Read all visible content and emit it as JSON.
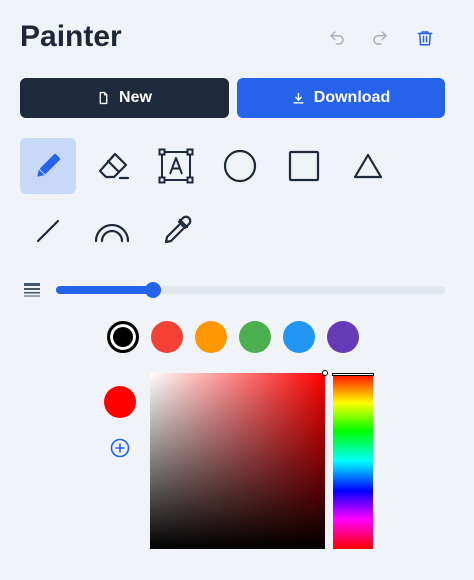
{
  "header": {
    "title": "Painter"
  },
  "actions": {
    "new_label": "New",
    "download_label": "Download"
  },
  "tools": [
    {
      "name": "pencil",
      "icon": "pencil-icon",
      "active": true
    },
    {
      "name": "eraser",
      "icon": "eraser-icon",
      "active": false
    },
    {
      "name": "text",
      "icon": "text-box-icon",
      "active": false
    },
    {
      "name": "circle",
      "icon": "circle-icon",
      "active": false
    },
    {
      "name": "square",
      "icon": "square-icon",
      "active": false
    },
    {
      "name": "triangle",
      "icon": "triangle-icon",
      "active": false
    },
    {
      "name": "line",
      "icon": "line-icon",
      "active": false
    },
    {
      "name": "arc",
      "icon": "arc-icon",
      "active": false
    },
    {
      "name": "eyedropper",
      "icon": "eyedropper-icon",
      "active": false
    }
  ],
  "brush_size": {
    "icon": "line-weight-icon",
    "value_fraction": 0.25
  },
  "palette": [
    {
      "color": "#000000",
      "selected": true
    },
    {
      "color": "#f44336",
      "selected": false
    },
    {
      "color": "#ff9800",
      "selected": false
    },
    {
      "color": "#4caf50",
      "selected": false
    },
    {
      "color": "#2196f3",
      "selected": false
    },
    {
      "color": "#673ab7",
      "selected": false
    }
  ],
  "color_picker": {
    "current_color": "#ff0000",
    "hue_fraction": 0.0,
    "saturation": 1.0,
    "value": 1.0
  },
  "theme": {
    "accent": "#2563eb",
    "dark": "#1e293b",
    "active_tool_bg": "#c8d9f8",
    "icon_color": "#1e293b"
  }
}
